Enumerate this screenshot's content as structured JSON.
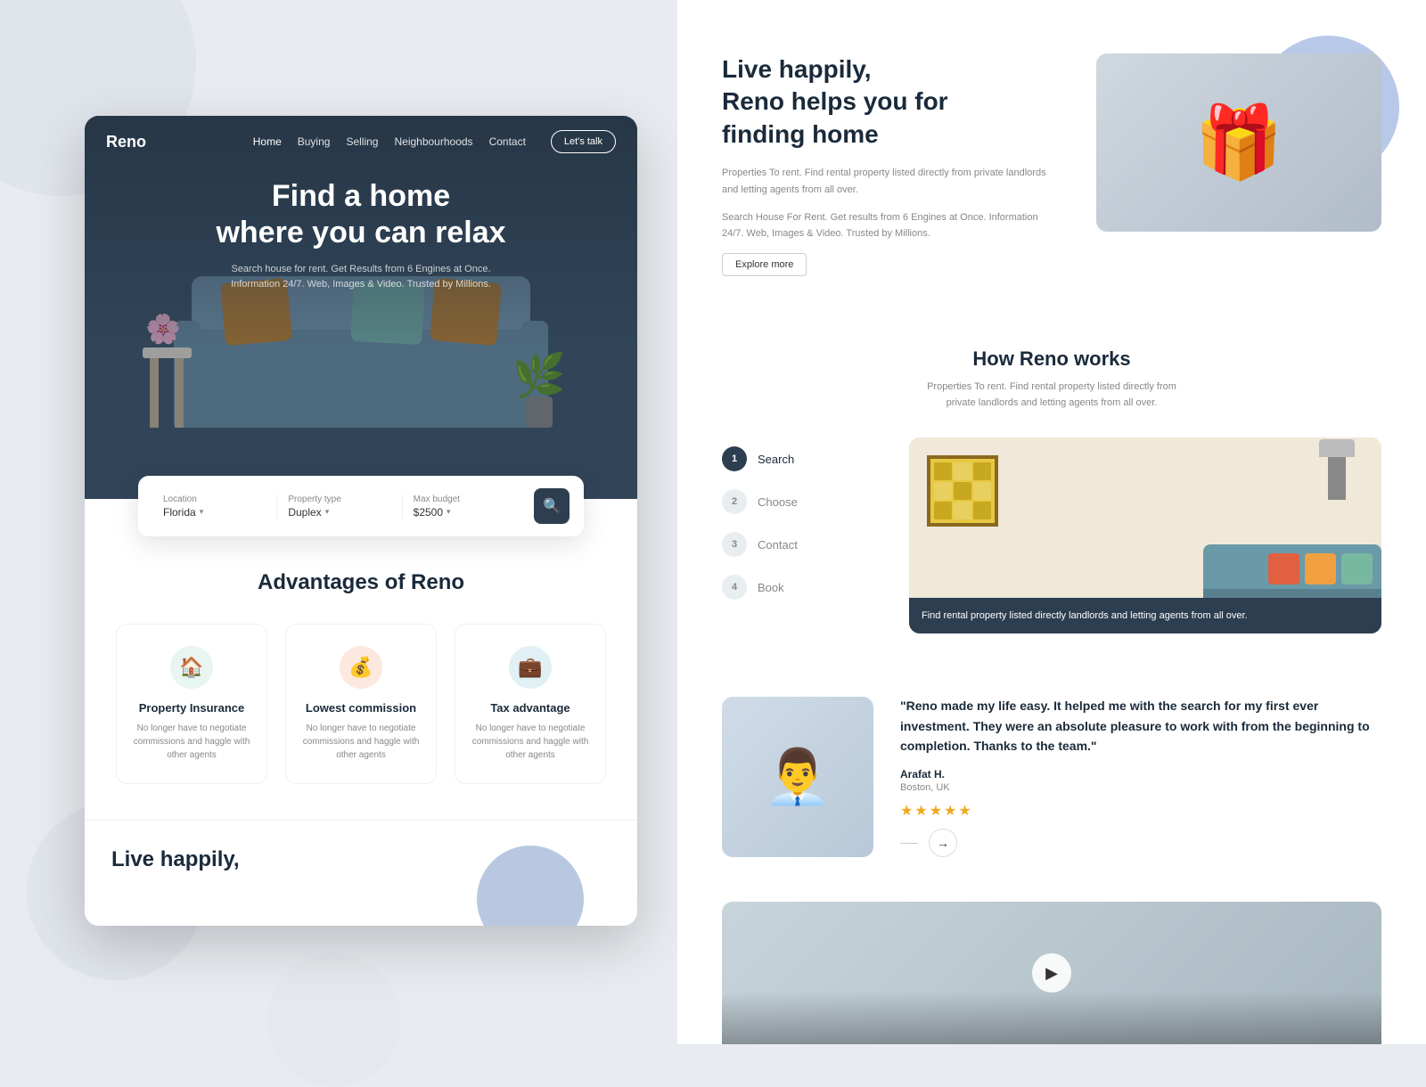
{
  "meta": {
    "background_color": "#e8ecf0"
  },
  "brand": {
    "logo": "Reno"
  },
  "nav": {
    "links": [
      "Home",
      "Buying",
      "Selling",
      "Neighbourhoods",
      "Contact"
    ],
    "active_link": "Home",
    "cta_label": "Let's talk"
  },
  "hero": {
    "title_line1": "Find a home",
    "title_line2": "where you can relax",
    "subtitle": "Search house for rent. Get Results from 6 Engines at Once. Information 24/7. Web, Images & Video. Trusted by Millions."
  },
  "search_bar": {
    "location_label": "Location",
    "location_value": "Florida",
    "property_label": "Property type",
    "property_value": "Duplex",
    "budget_label": "Max budget",
    "budget_value": "$2500",
    "search_label": "Search"
  },
  "advantages": {
    "title": "Advantages of Reno",
    "items": [
      {
        "icon": "🏠",
        "icon_color": "green",
        "name": "Property Insurance",
        "desc": "No longer have to negotiate commissions and haggle with other agents"
      },
      {
        "icon": "💰",
        "icon_color": "orange",
        "name": "Lowest commission",
        "desc": "No longer have to negotiate commissions and haggle with other agents"
      },
      {
        "icon": "💼",
        "icon_color": "teal",
        "name": "Tax advantage",
        "desc": "No longer have to negotiate commissions and haggle with other agents"
      }
    ]
  },
  "live_happily_teaser": {
    "title": "Live happily,"
  },
  "right_live_happily": {
    "title_line1": "Live happily,",
    "title_line2": "Reno helps you for",
    "title_line3": "finding home",
    "para1": "Properties To rent. Find rental property listed directly from private landlords and letting agents from all over.",
    "para2": "Search House For Rent. Get results from 6 Engines at Once. Information 24/7. Web, Images & Video. Trusted by Millions.",
    "explore_label": "Explore more"
  },
  "how_works": {
    "title": "How Reno works",
    "desc": "Properties To rent. Find rental property listed directly from private landlords and letting agents from all over.",
    "steps": [
      {
        "num": "1",
        "label": "Search",
        "active": true
      },
      {
        "num": "2",
        "label": "Choose",
        "active": false
      },
      {
        "num": "3",
        "label": "Contact",
        "active": false
      },
      {
        "num": "4",
        "label": "Book",
        "active": false
      }
    ],
    "room_caption": "Find rental property listed directly landlords and letting agents from all over."
  },
  "testimonial": {
    "quote": "\"Reno made my life easy. It helped me with the search for my first ever investment. They were an absolute pleasure to work with from the beginning to completion. Thanks to the team.\"",
    "author": "Arafat H.",
    "location": "Boston, UK",
    "stars": "★★★★★",
    "star_count": 5
  }
}
